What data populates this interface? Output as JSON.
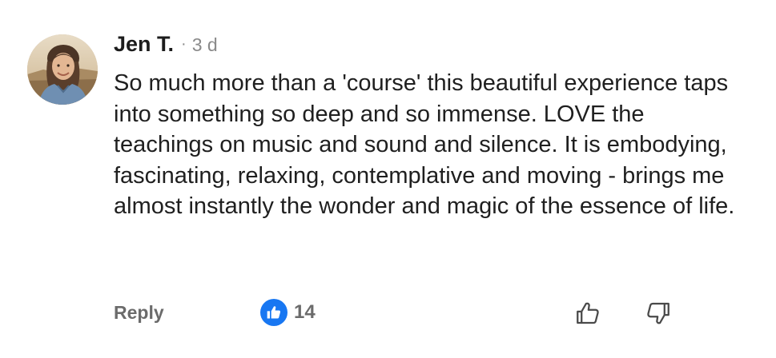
{
  "comment": {
    "author": "Jen T.",
    "separator": "·",
    "time": "3 d",
    "text": "So much more than a 'course' this beautiful experience taps into something so deep and so immense. LOVE the teachings on music and sound and silence. It is embodying, fascinating, relaxing, contemplative and moving - brings me almost instantly the wonder and magic of the essence of life.",
    "reply_label": "Reply",
    "like_count": "14",
    "like_icon": "thumbs-up-filled-icon",
    "upvote_icon": "thumbs-up-outline-icon",
    "downvote_icon": "thumbs-down-outline-icon",
    "avatar": "user-avatar-photo"
  },
  "colors": {
    "like_badge": "#1877f2",
    "text": "#1f1f1f",
    "muted": "#8a8a8a",
    "action": "#6b6b6b"
  }
}
